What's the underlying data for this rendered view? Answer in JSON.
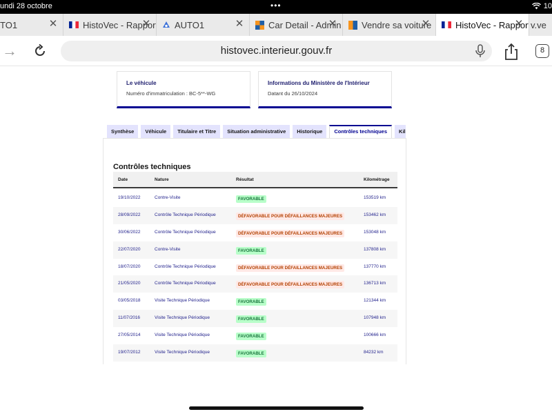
{
  "status": {
    "time": "undi 28 octobre",
    "battery": "10"
  },
  "tabs": [
    {
      "title": "TO1",
      "favicon": "auto1-icon"
    },
    {
      "title": "HistoVec - Rapport",
      "favicon": "fr-flag-icon"
    },
    {
      "title": "AUTO1",
      "favicon": "auto1-icon"
    },
    {
      "title": "Car Detail - Admin",
      "favicon": "orange-square-icon"
    },
    {
      "title": "Vendre sa voiture",
      "favicon": "orange-blue-icon"
    },
    {
      "title": "HistoVec - Rapport",
      "favicon": "fr-flag-icon",
      "active": true
    },
    {
      "title": "v.ve"
    }
  ],
  "toolbar": {
    "url": "histovec.interieur.gouv.fr",
    "tab_count": "8"
  },
  "cards": {
    "vehicule": {
      "title": "Le véhicule",
      "value": "Numéro d'immatriculation : BC-5**-WG"
    },
    "ministere": {
      "title": "Informations du Ministère de l'Intérieur",
      "value": "Datant du 26/10/2024"
    }
  },
  "page_tabs": [
    "Synthèse",
    "Véhicule",
    "Titulaire et Titre",
    "Situation administrative",
    "Historique",
    "Contrôles techniques",
    "Kil"
  ],
  "section_title": "Contrôles techniques",
  "table": {
    "headers": {
      "date": "Date",
      "nature": "Nature",
      "resultat": "Résultat",
      "km": "Kilométrage"
    },
    "rows": [
      {
        "date": "19/10/2022",
        "nature": "Contre-Visite",
        "resultat": "FAVORABLE",
        "km": "153519 km"
      },
      {
        "date": "28/09/2022",
        "nature": "Contrôle Technique Périodique",
        "resultat": "DÉFAVORABLE POUR DÉFAILLANCES MAJEURES",
        "km": "153462 km"
      },
      {
        "date": "30/06/2022",
        "nature": "Contrôle Technique Périodique",
        "resultat": "DÉFAVORABLE POUR DÉFAILLANCES MAJEURES",
        "km": "153048 km"
      },
      {
        "date": "22/07/2020",
        "nature": "Contre-Visite",
        "resultat": "FAVORABLE",
        "km": "137808 km"
      },
      {
        "date": "18/07/2020",
        "nature": "Contrôle Technique Périodique",
        "resultat": "DÉFAVORABLE POUR DÉFAILLANCES MAJEURES",
        "km": "137770 km"
      },
      {
        "date": "21/05/2020",
        "nature": "Contrôle Technique Périodique",
        "resultat": "DÉFAVORABLE POUR DÉFAILLANCES MAJEURES",
        "km": "136713 km"
      },
      {
        "date": "03/05/2018",
        "nature": "Visite Technique Périodique",
        "resultat": "FAVORABLE",
        "km": "121344 km"
      },
      {
        "date": "11/07/2016",
        "nature": "Visite Technique Périodique",
        "resultat": "FAVORABLE",
        "km": "107948 km"
      },
      {
        "date": "27/05/2014",
        "nature": "Visite Technique Périodique",
        "resultat": "FAVORABLE",
        "km": "100666 km"
      },
      {
        "date": "19/07/2012",
        "nature": "Visite Technique Périodique",
        "resultat": "FAVORABLE",
        "km": "84232 km"
      }
    ]
  },
  "colors": {
    "brand": "#000091",
    "ok_bg": "#b8fec9",
    "ok_fg": "#18753c",
    "ko_bg": "#ffe9e6",
    "ko_fg": "#b34000"
  }
}
